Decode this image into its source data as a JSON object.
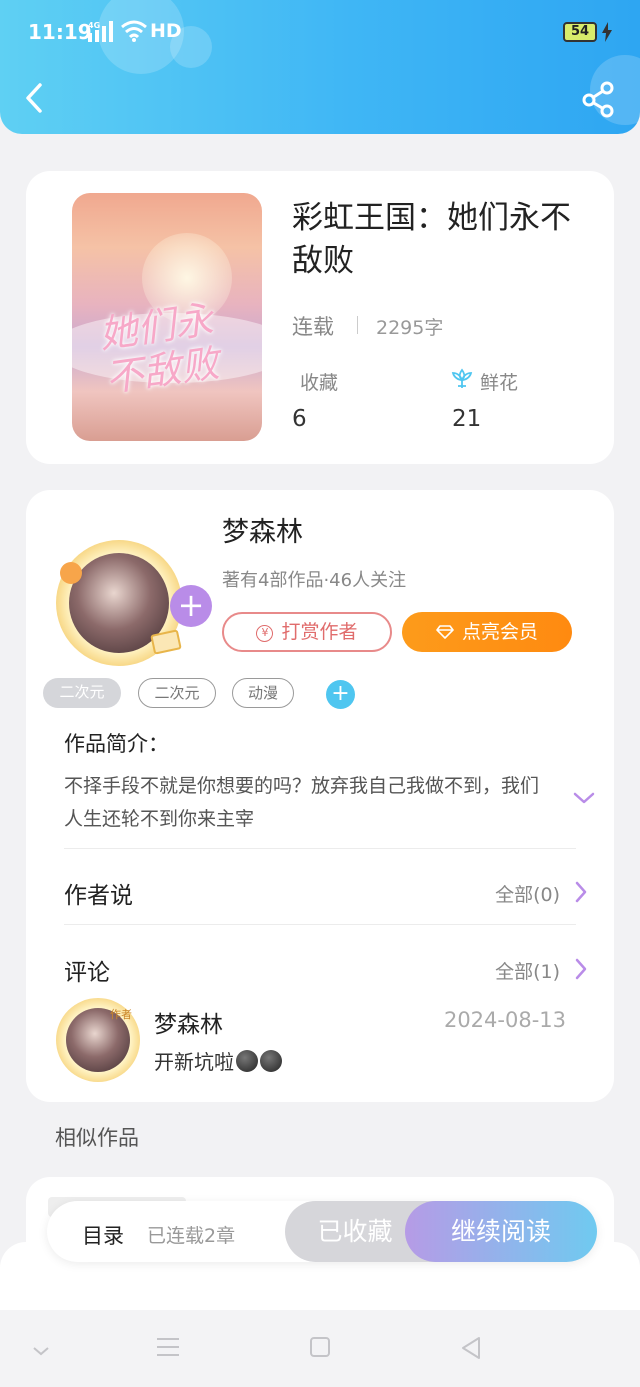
{
  "status_bar": {
    "time": "11:19",
    "network": "4G",
    "hd": "HD",
    "battery": "54"
  },
  "header": {
    "back_icon": "chevron-left-icon",
    "share_icon": "share-icon"
  },
  "book": {
    "title": "彩虹王国：她们永不敌败",
    "status": "连载",
    "words": "2295字",
    "cover_text": "她们永不敌败",
    "stats": {
      "favorites_label": "收藏",
      "favorites_value": "6",
      "flowers_label": "鲜花",
      "flowers_value": "21"
    }
  },
  "author": {
    "name": "梦森林",
    "meta": "著有4部作品·46人关注",
    "tip_label": "打赏作者",
    "vip_label": "点亮会员",
    "tags": [
      "二次元",
      "二次元",
      "动漫"
    ],
    "follow_symbol": "+",
    "add_tag_symbol": "+"
  },
  "intro": {
    "title": "作品简介：",
    "text": "不择手段不就是你想要的吗？放弃我自己我做不到，我们人生还轮不到你来主宰"
  },
  "author_says": {
    "title": "作者说",
    "link": "全部(0)"
  },
  "comments": {
    "title": "评论",
    "link": "全部(1)",
    "items": [
      {
        "name": "梦森林",
        "badge": "作者",
        "date": "2024-08-13",
        "text": "开新坑啦"
      }
    ]
  },
  "similar": {
    "title": "相似作品"
  },
  "action_bar": {
    "toc_label": "目录",
    "toc_count": "已连载2章",
    "fav_label": "已收藏",
    "read_label": "继续阅读"
  },
  "colors": {
    "header_start": "#5fd0f3",
    "header_end": "#2ea6f2",
    "accent_purple": "#b98ce8",
    "vip_orange": "#fd9b1b",
    "tip_red": "#e06c6c"
  }
}
